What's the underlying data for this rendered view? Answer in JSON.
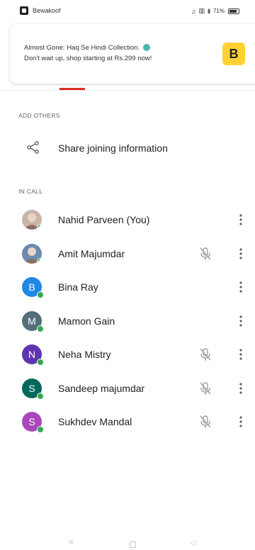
{
  "status_bar": {
    "app_name": "Bewakoof",
    "battery_text": "71%",
    "network_text": "ill",
    "icons": [
      "headphones-icon",
      "vibrate-icon",
      "signal-icon",
      "battery-icon"
    ]
  },
  "notification": {
    "line1": "Almost Gone: Haq Se Hindi Collection.",
    "line2": "Don't wait up, shop starting at Rs.299 now!",
    "logo_letter": "B",
    "logo_color": "#ffd232"
  },
  "sections": {
    "add_others_label": "ADD OTHERS",
    "in_call_label": "IN CALL"
  },
  "share": {
    "label": "Share joining information",
    "icon": "share-icon"
  },
  "participants": [
    {
      "name": "Nahid Parveen (You)",
      "initial": "",
      "avatar_color": "#c9b5a8",
      "photo": true,
      "muted": false
    },
    {
      "name": "Amit Majumdar",
      "initial": "",
      "avatar_color": "#6a8caf",
      "photo": true,
      "muted": true
    },
    {
      "name": "Bina Ray",
      "initial": "B",
      "avatar_color": "#1e88e5",
      "photo": false,
      "muted": false
    },
    {
      "name": "Mamon Gain",
      "initial": "M",
      "avatar_color": "#546e7a",
      "photo": false,
      "muted": false
    },
    {
      "name": "Neha Mistry",
      "initial": "N",
      "avatar_color": "#5e35b1",
      "photo": false,
      "muted": true
    },
    {
      "name": "Sandeep majumdar",
      "initial": "S",
      "avatar_color": "#00695c",
      "photo": false,
      "muted": true
    },
    {
      "name": "Sukhdev Mandal",
      "initial": "S",
      "avatar_color": "#ab47bc",
      "photo": false,
      "muted": true
    }
  ],
  "colors": {
    "online": "#34a853",
    "accent_red": "#d93025"
  },
  "nav_bar": {
    "icons": [
      "menu-icon",
      "home-icon",
      "back-icon"
    ]
  }
}
